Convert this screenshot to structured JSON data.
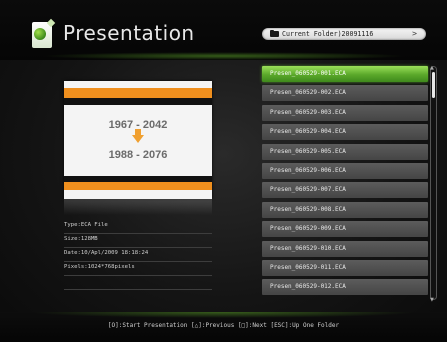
{
  "header": {
    "title": "Presentation",
    "folder_label": "Current Folder)20091116",
    "folder_chevron": ">",
    "app_icon": "presentation-app-icon"
  },
  "preview": {
    "line1": "1967 - 2042",
    "line2": "1988 - 2076",
    "accent_color": "#ef8f1e"
  },
  "info": {
    "type": "Type:ECA File",
    "size": "Size:128MB",
    "date": "Date:10/Apl/2009 18:18:24",
    "pixels": "Pixels:1024*768pixels"
  },
  "files": [
    {
      "name": "Presen_060529-001.ECA",
      "selected": true
    },
    {
      "name": "Presen_060529-002.ECA",
      "selected": false
    },
    {
      "name": "Presen_060529-003.ECA",
      "selected": false
    },
    {
      "name": "Presen_060529-004.ECA",
      "selected": false
    },
    {
      "name": "Presen_060529-005.ECA",
      "selected": false
    },
    {
      "name": "Presen_060529-006.ECA",
      "selected": false
    },
    {
      "name": "Presen_060529-007.ECA",
      "selected": false
    },
    {
      "name": "Presen_060529-008.ECA",
      "selected": false
    },
    {
      "name": "Presen_060529-009.ECA",
      "selected": false
    },
    {
      "name": "Presen_060529-010.ECA",
      "selected": false
    },
    {
      "name": "Presen_060529-011.ECA",
      "selected": false
    },
    {
      "name": "Presen_060529-012.ECA",
      "selected": false
    }
  ],
  "footer": {
    "hint": "[O]:Start Presentation [△]:Previous [□]:Next [ESC]:Up One Folder"
  },
  "colors": {
    "selected": "#5aa82a",
    "item": "#4f4f4f"
  }
}
